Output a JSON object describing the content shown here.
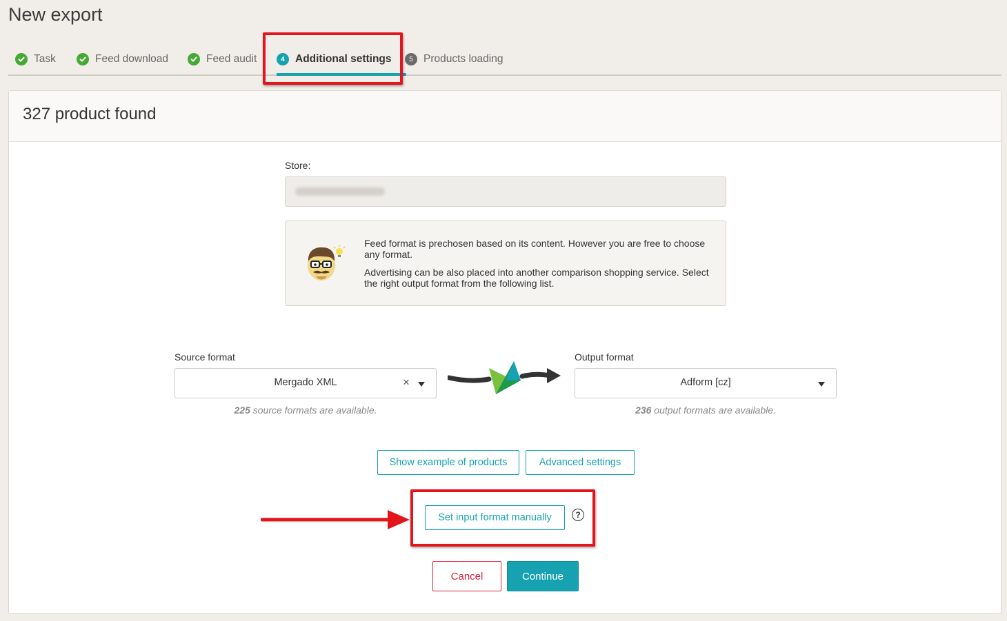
{
  "page": {
    "title": "New export"
  },
  "steps": [
    {
      "label": "Task",
      "state": "done"
    },
    {
      "label": "Feed download",
      "state": "done"
    },
    {
      "label": "Feed audit",
      "state": "done"
    },
    {
      "label": "Additional settings",
      "state": "current",
      "number": "4"
    },
    {
      "label": "Products loading",
      "state": "todo",
      "number": "5"
    }
  ],
  "card": {
    "header": "327 product found"
  },
  "store": {
    "label": "Store:"
  },
  "info": {
    "line1": "Feed format is prechosen based on its content. However you are free to choose any format.",
    "line2": "Advertising can be also placed into another comparison shopping service. Select the right output format from the following list."
  },
  "source": {
    "label": "Source format",
    "value": "Mergado XML",
    "clear_glyph": "×",
    "hint_count": "225",
    "hint_text": " source formats are available."
  },
  "output": {
    "label": "Output format",
    "value": "Adform [cz]",
    "hint_count": "236",
    "hint_text": " output formats are available."
  },
  "buttons": {
    "show_example": "Show example of products",
    "advanced": "Advanced settings",
    "set_input": "Set input format manually",
    "help": "?",
    "cancel": "Cancel",
    "continue": "Continue"
  },
  "colors": {
    "accent": "#16a2b0",
    "done": "#45a935",
    "danger": "#d6233a",
    "annotation": "#e3141c"
  },
  "icons": {
    "done": "check-circle-icon",
    "arrow": "conversion-arrow-icon",
    "mascot": "mascot-idea-icon"
  }
}
